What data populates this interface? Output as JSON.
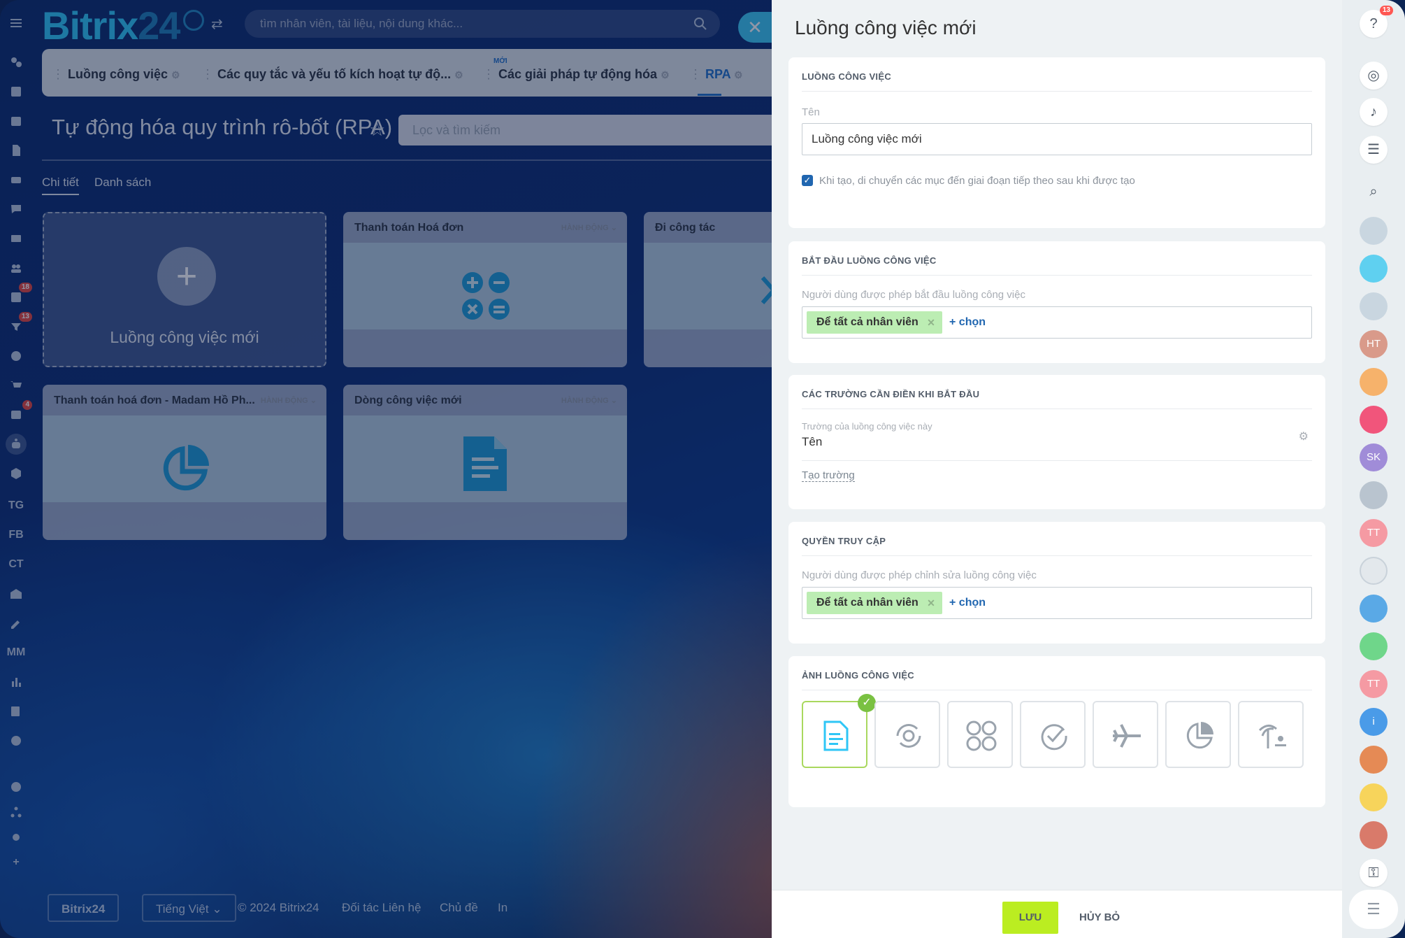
{
  "app": {
    "logo_main": "Bitrix",
    "logo_num": "24"
  },
  "search": {
    "placeholder": "tìm nhân viên, tài liệu, nội dung khác..."
  },
  "left_sidebar": {
    "badges": {
      "tasks": "18",
      "feed": "13",
      "contacts": "4"
    },
    "text_items": [
      "TG",
      "FB",
      "CT",
      "MM"
    ]
  },
  "tabs": [
    {
      "label": "Luồng công việc"
    },
    {
      "label": "Các quy tắc và yếu tố kích hoạt tự độ..."
    },
    {
      "label": "Các giải pháp tự động hóa",
      "badge": "MỚI"
    },
    {
      "label": "RPA"
    }
  ],
  "page": {
    "title": "Tự động hóa quy trình rô-bốt (RPA)",
    "filter_placeholder": "Lọc và tìm kiếm",
    "view_tabs": [
      "Chi tiết",
      "Danh sách"
    ]
  },
  "cards": {
    "new_label": "Luồng công việc mới",
    "action_label": "HÀNH ĐỘNG",
    "items": [
      {
        "title": "Thanh toán Hoá đơn",
        "icon": "calculator-icon"
      },
      {
        "title": "Đi công tác",
        "icon": "plane-icon"
      },
      {
        "title": "Thanh toán hoá đơn - Madam Hồ Ph...",
        "icon": "pie-chart-icon"
      },
      {
        "title": "Dòng công việc mới",
        "icon": "document-icon"
      }
    ]
  },
  "footer": {
    "brand": "Bitrix24",
    "language": "Tiếng Việt",
    "copyright": "© 2024 Bitrix24",
    "links": [
      "Đối tác Liên hệ",
      "Chủ đề",
      "In"
    ]
  },
  "panel": {
    "title": "Luồng công việc mới",
    "workflow": {
      "section_title": "LUỒNG CÔNG VIỆC",
      "name_label": "Tên",
      "name_value": "Luồng công việc mới",
      "checkbox_label": "Khi tạo, di chuyển các mục đến giai đoạn tiếp theo sau khi được tạo",
      "checkbox_checked": true
    },
    "start": {
      "section_title": "BẮT ĐẦU LUỒNG CÔNG VIỆC",
      "label": "Người dùng được phép bắt đầu luồng công việc",
      "entity": "Để tất cả nhân viên",
      "add_label": "+ chọn"
    },
    "fields": {
      "section_title": "CÁC TRƯỜNG CẦN ĐIỀN KHI BẮT ĐẦU",
      "small_label": "Trường của luồng công việc này",
      "field_name": "Tên",
      "create_label": "Tạo trường"
    },
    "access": {
      "section_title": "QUYỀN TRUY CẬP",
      "label": "Người dùng được phép chỉnh sửa luồng công việc",
      "entity": "Để tất cả nhân viên",
      "add_label": "+ chọn"
    },
    "image": {
      "section_title": "ẢNH LUỒNG CÔNG VIỆC",
      "icons": [
        "document-icon",
        "refresh-gear-icon",
        "calculator-icon",
        "check-circle-icon",
        "plane-icon",
        "pie-chart-icon",
        "palm-tree-icon"
      ],
      "selected": "document-icon"
    },
    "buttons": {
      "save": "LƯU",
      "cancel": "HỦY BỎ"
    }
  },
  "right_bar": {
    "help_badge": "13",
    "avatars": [
      "HT",
      "SK",
      "TT",
      "TT"
    ]
  },
  "colors": {
    "accent": "#2fc6f6",
    "save": "#bbed21",
    "entity": "#bcedb3",
    "link": "#2066b0"
  }
}
